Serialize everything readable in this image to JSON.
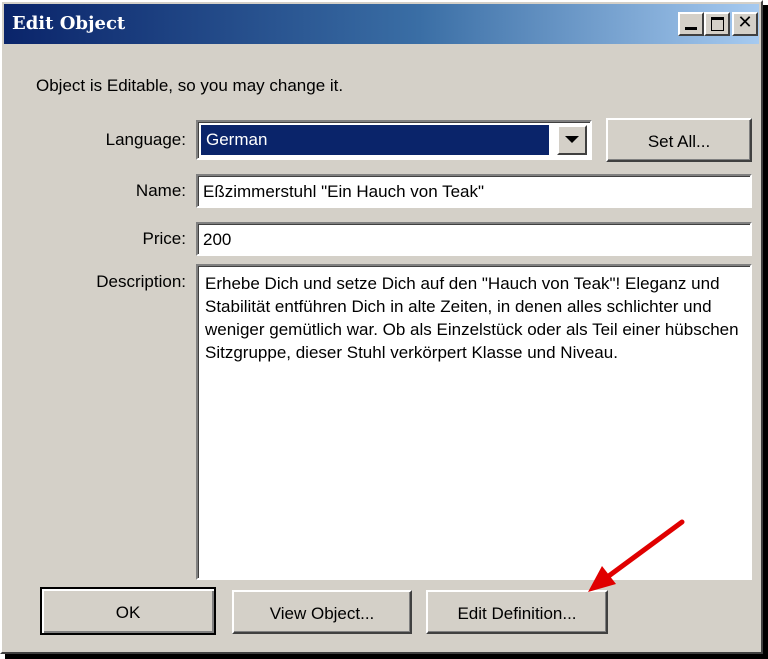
{
  "window": {
    "title": "Edit Object",
    "minimize_icon": "minimize-icon",
    "maximize_icon": "maximize-icon",
    "close_glyph": "✕"
  },
  "info_text": "Object is Editable, so you may change it.",
  "form": {
    "language_label": "Language:",
    "language_value": "German",
    "set_all_label": "Set All...",
    "name_label": "Name:",
    "name_value": "Eßzimmerstuhl \"Ein Hauch von Teak\"",
    "price_label": "Price:",
    "price_value": "200",
    "description_label": "Description:",
    "description_value": "Erhebe Dich und setze Dich auf den \"Hauch von Teak\"! Eleganz und Stabilität entführen Dich in alte Zeiten, in denen alles schlichter und weniger gemütlich war. Ob als Einzelstück oder als Teil einer hübschen Sitzgruppe, dieser Stuhl verkörpert Klasse und Niveau."
  },
  "buttons": {
    "ok": "OK",
    "view_object": "View Object...",
    "edit_definition": "Edit Definition..."
  },
  "colors": {
    "title_gradient_start": "#0a246a",
    "title_gradient_end": "#a6caf0",
    "selection": "#0a246a",
    "dialog_face": "#d4d0c8",
    "annotation_arrow": "#e00000"
  }
}
